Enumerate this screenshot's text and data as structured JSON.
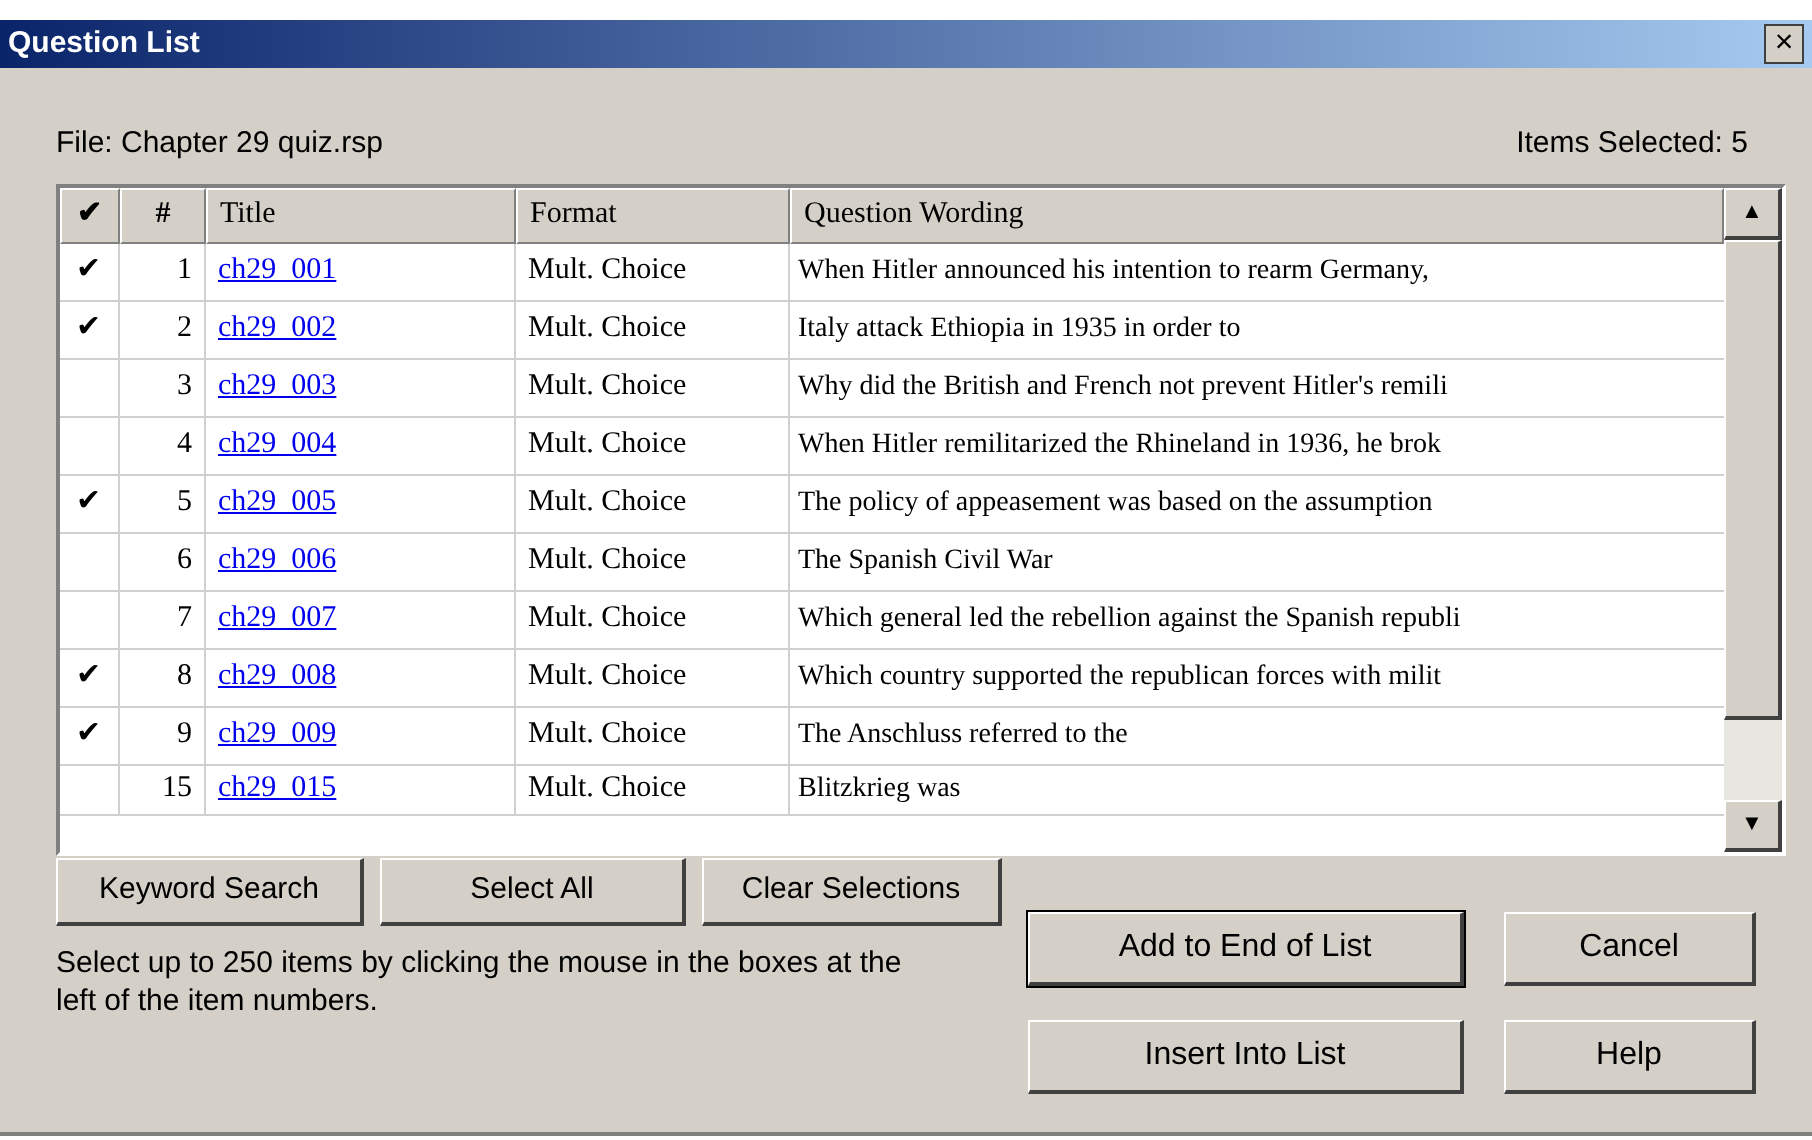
{
  "window": {
    "title": "Question List",
    "close": "×"
  },
  "file_label": "File: Chapter 29 quiz.rsp",
  "items_selected": "Items Selected: 5",
  "table": {
    "columns": [
      {
        "label": "✔"
      },
      {
        "label": "#"
      },
      {
        "label": "Title"
      },
      {
        "label": "Format"
      },
      {
        "label": "Question Wording"
      }
    ],
    "rows": [
      {
        "checked": true,
        "number": "1",
        "title": "ch29_001",
        "format": "Mult. Choice",
        "wording": "When Hitler announced his intention to rearm Germany,"
      },
      {
        "checked": true,
        "number": "2",
        "title": "ch29_002",
        "format": "Mult. Choice",
        "wording": "Italy attack Ethiopia in 1935 in order to"
      },
      {
        "checked": false,
        "number": "3",
        "title": "ch29_003",
        "format": "Mult. Choice",
        "wording": "Why did the British and French not prevent Hitler's remili"
      },
      {
        "checked": false,
        "number": "4",
        "title": "ch29_004",
        "format": "Mult. Choice",
        "wording": "When Hitler remilitarized the Rhineland in 1936, he brok"
      },
      {
        "checked": true,
        "number": "5",
        "title": "ch29_005",
        "format": "Mult. Choice",
        "wording": "The policy of appeasement was based on the assumption"
      },
      {
        "checked": false,
        "number": "6",
        "title": "ch29_006",
        "format": "Mult. Choice",
        "wording": "The Spanish Civil War"
      },
      {
        "checked": false,
        "number": "7",
        "title": "ch29_007",
        "format": "Mult. Choice",
        "wording": "Which general led the rebellion against the Spanish republi"
      },
      {
        "checked": true,
        "number": "8",
        "title": "ch29_008",
        "format": "Mult. Choice",
        "wording": "Which country supported the republican forces with milit"
      },
      {
        "checked": true,
        "number": "9",
        "title": "ch29_009",
        "format": "Mult. Choice",
        "wording": "The Anschluss referred to the"
      },
      {
        "checked": false,
        "number": "15",
        "title": "ch29_015",
        "format": "Mult. Choice",
        "wording": "Blitzkrieg was"
      }
    ],
    "check_mark": "✔"
  },
  "scrollbar": {
    "up": "▲",
    "down": "▼"
  },
  "buttons_left": [
    "Keyword Search",
    "Select All",
    "Clear Selections"
  ],
  "hint": "Select up to 250 items by clicking the mouse in the boxes at the left of the item numbers.",
  "buttons_right": [
    {
      "label": "Add to End of List",
      "default": true
    },
    {
      "label": "Cancel",
      "default": false
    },
    {
      "label": "Insert Into List",
      "default": false
    },
    {
      "label": "Help",
      "default": false
    }
  ]
}
